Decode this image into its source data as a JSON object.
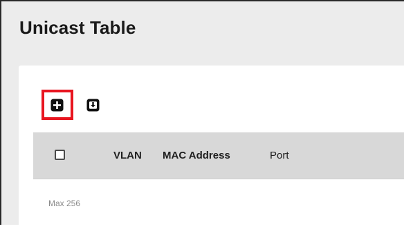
{
  "page": {
    "title": "Unicast Table"
  },
  "toolbar": {
    "add_icon": "plus-square-icon",
    "export_icon": "download-box-icon",
    "highlight_color": "#e8151f"
  },
  "table": {
    "columns": [
      "VLAN",
      "MAC Address",
      "Port"
    ],
    "rows": [],
    "footer_text": "Max 256"
  }
}
